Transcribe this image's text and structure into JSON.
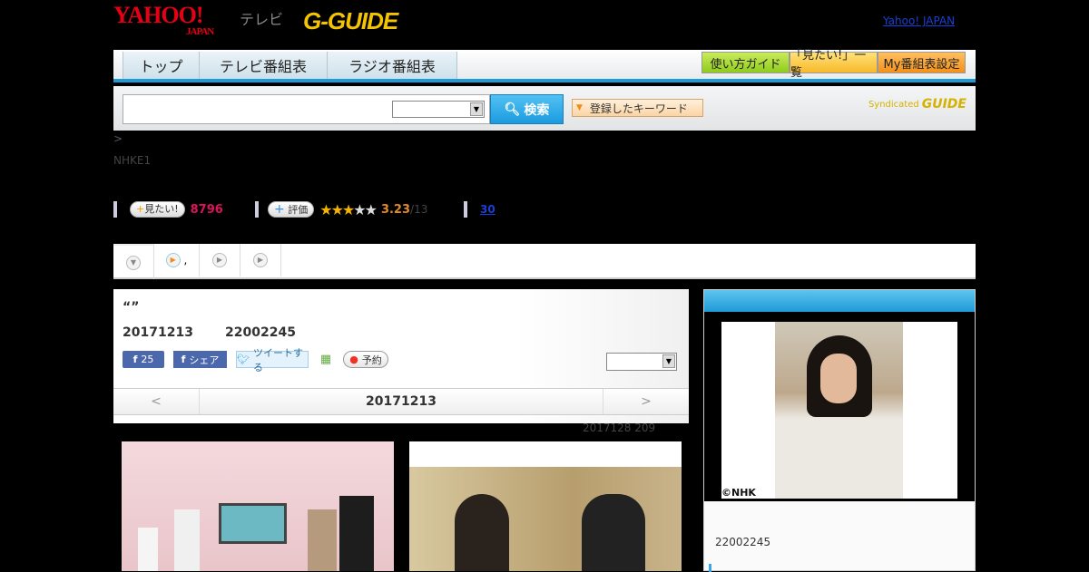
{
  "header": {
    "logo_yahoo": "YAHOO!",
    "logo_japan": "JAPAN",
    "logo_tv": "テレビ",
    "logo_gguide": "G-GUIDE",
    "yahoo_japan_link": "Yahoo! JAPAN"
  },
  "nav": {
    "tabs": [
      "トップ",
      "テレビ番組表",
      "ラジオ番組表"
    ],
    "buttons": [
      "使い方ガイド",
      "「見たい!」一覧",
      "My番組表設定"
    ]
  },
  "search": {
    "placeholder": "",
    "button": "検索",
    "keyword_button": "登録したキーワード",
    "syndicated": "Syndicated",
    "syndicated_logo": "GUIDE"
  },
  "breadcrumb": ">",
  "channel": "NHKE1",
  "stats": {
    "mitai_label": "見たい!",
    "mitai_count": "8796",
    "rating_label": "評価",
    "rating": 3.23,
    "rating_text": "3.23",
    "rating_count": "/13",
    "comment_link": "30"
  },
  "program": {
    "title": "“”",
    "date": "20171213",
    "time": "22002245",
    "fb_count": "25",
    "fb_share": "シェア",
    "tweet": "ツイートする",
    "reserve": "予約",
    "pager_prev": "<",
    "pager_date": "20171213",
    "pager_next": ">",
    "update_note": "2017128  209"
  },
  "sidebar": {
    "copyright": "©NHK",
    "time": "22002245"
  }
}
